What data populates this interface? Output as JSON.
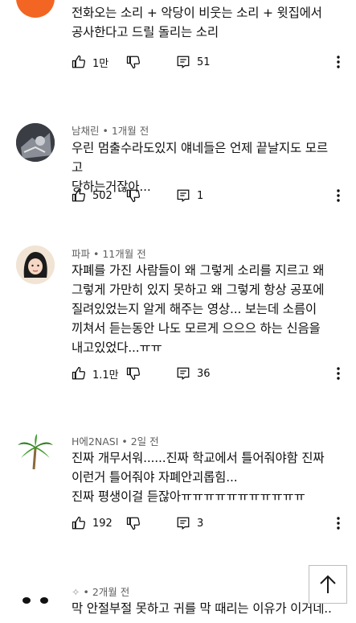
{
  "comments": [
    {
      "text": "전화오는 소리 + 악당이 비웃는 소리 + 윗집에서\n공사한다고 드릴 돌리는 소리",
      "likes": "1만",
      "replies": "51"
    },
    {
      "author": "남채린",
      "time": "1개월 전",
      "text": "우린 멈출수라도있지 얘네들은 언제 끝날지도 모르고\n당하는거잖아...",
      "likes": "502",
      "replies": "1"
    },
    {
      "author": "파파",
      "time": "11개월 전",
      "text": "자폐를 가진 사람들이 왜 그렇게 소리를 지르고 왜\n그렇게 가만히 있지 못하고 왜 그렇게 항상 공포에\n질려있었는지 알게 해주는 영상... 보는데 소름이\n끼쳐서 듣는동안 나도 모르게 으으으 하는 신음을\n내고있었다...ㅠㅠ",
      "likes": "1.1만",
      "replies": "36"
    },
    {
      "author": "H에2NASI",
      "time": "2일 전",
      "text": "진짜 개무서워......진짜 학교에서 틀어줘야함 진짜\n이런거 틀어줘야 자폐안괴롭힘...\n진짜 평생이걸 듣잖아ㅠㅠㅠㅠㅠㅠㅠㅠㅠㅠㅠ",
      "likes": "192",
      "replies": "3"
    },
    {
      "author": "",
      "time": "2개월 전",
      "text": "막 안절부절 못하고 귀를 막 때리는 이유가 이거네.."
    }
  ],
  "separator": " • ",
  "colors": {
    "avatar_orange": "#f26522",
    "meta": "#606060",
    "text": "#0f0f0f"
  },
  "icons": [
    "thumb-up-icon",
    "thumb-down-icon",
    "reply-icon",
    "more-vert-icon",
    "arrow-up-icon"
  ]
}
